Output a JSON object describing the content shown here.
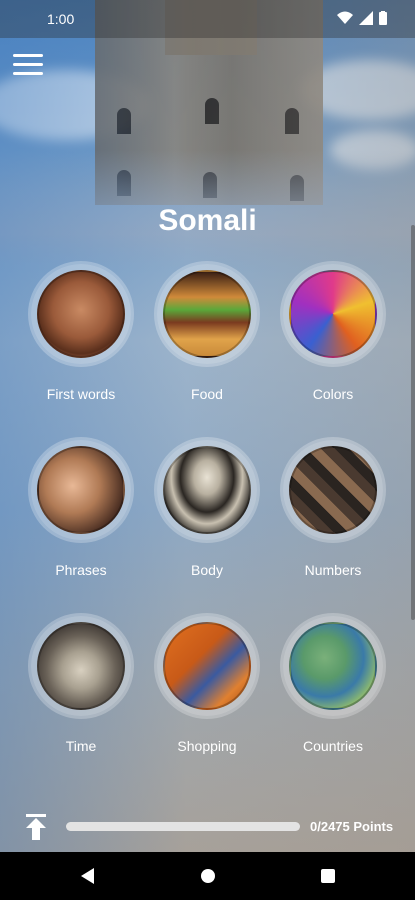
{
  "status": {
    "time": "1:00",
    "icons": [
      "wifi-icon",
      "signal-icon",
      "battery-icon"
    ]
  },
  "header": {
    "menu_icon": "hamburger-menu-icon",
    "title": "Somali"
  },
  "categories": [
    {
      "label": "First words",
      "icon": "child-photo"
    },
    {
      "label": "Food",
      "icon": "burger-photo"
    },
    {
      "label": "Colors",
      "icon": "color-powder-photo"
    },
    {
      "label": "Phrases",
      "icon": "smiling-woman-photo"
    },
    {
      "label": "Body",
      "icon": "skeleton-photo"
    },
    {
      "label": "Numbers",
      "icon": "number-blocks-photo"
    },
    {
      "label": "Time",
      "icon": "alarm-clock-photo"
    },
    {
      "label": "Shopping",
      "icon": "shopping-cart-photo"
    },
    {
      "label": "Countries",
      "icon": "world-map-photo"
    }
  ],
  "progress": {
    "text": "0/2475 Points",
    "fraction": 0
  },
  "colors": {
    "accent": "#4caf50",
    "text": "#ffffff"
  },
  "navbar": {
    "buttons": [
      "back-icon",
      "home-icon",
      "recents-icon"
    ]
  }
}
